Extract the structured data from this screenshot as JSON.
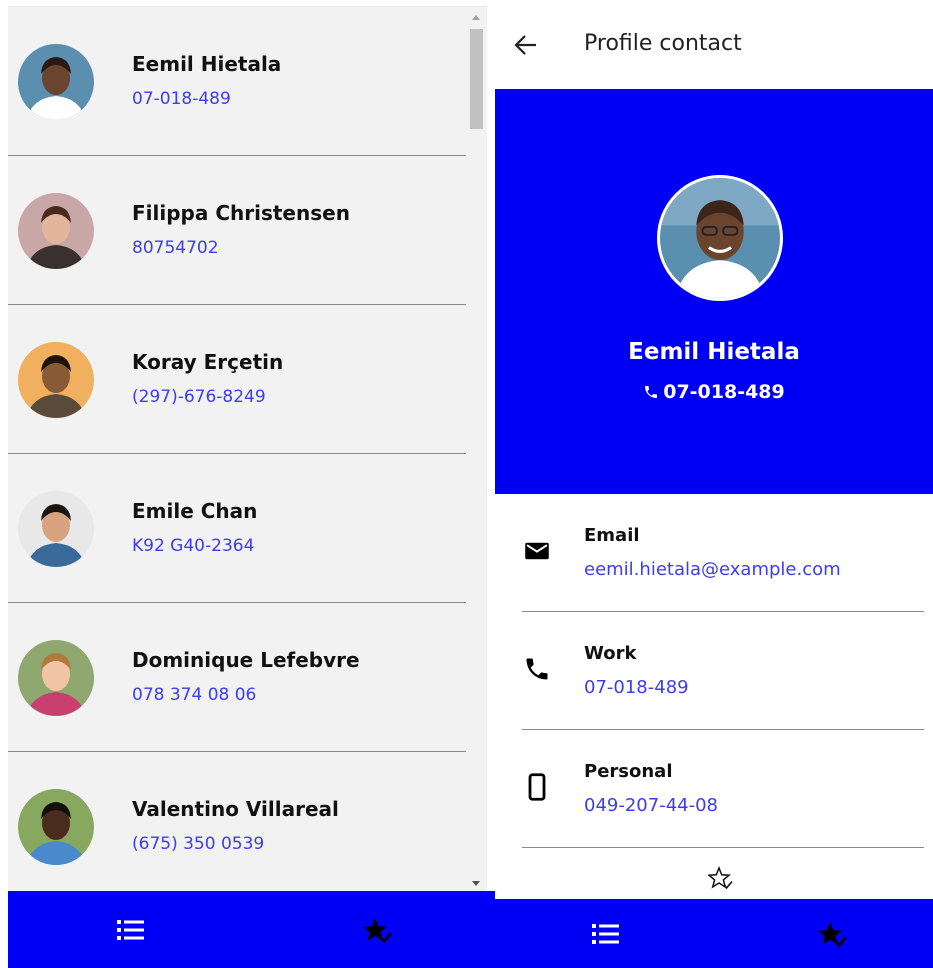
{
  "contacts": [
    {
      "name": "Eemil Hietala",
      "phone": "07-018-489",
      "skin": "#6b4430",
      "bg": "#5a8fb0",
      "hair": "#2a1a12",
      "shirt": "#ffffff"
    },
    {
      "name": "Filippa Christensen",
      "phone": "80754702",
      "skin": "#e2b69a",
      "bg": "#c9a7a6",
      "hair": "#4a2a1c",
      "shirt": "#3a3030"
    },
    {
      "name": "Koray Erçetin",
      "phone": "(297)-676-8249",
      "skin": "#8a5a36",
      "bg": "#f0b060",
      "hair": "#1e140e",
      "shirt": "#5a4a3a"
    },
    {
      "name": "Emile Chan",
      "phone": "K92 G40-2364",
      "skin": "#d9a27e",
      "bg": "#e8e8e8",
      "hair": "#1b1410",
      "shirt": "#3a6a9a"
    },
    {
      "name": "Dominique Lefebvre",
      "phone": "078 374 08 06",
      "skin": "#f0c4a4",
      "bg": "#8fa870",
      "hair": "#b07a3c",
      "shirt": "#c94070"
    },
    {
      "name": "Valentino Villareal",
      "phone": "(675) 350 0539",
      "skin": "#4a2c1c",
      "bg": "#88a860",
      "hair": "#141010",
      "shirt": "#4a8acc"
    }
  ],
  "profile": {
    "header_title": "Profile contact",
    "name": "Eemil Hietala",
    "phone": "07-018-489",
    "details": [
      {
        "label": "Email",
        "value": "eemil.hietala@example.com",
        "icon": "mail-icon"
      },
      {
        "label": "Work",
        "value": "07-018-489",
        "icon": "phone-icon"
      },
      {
        "label": "Personal",
        "value": "049-207-44-08",
        "icon": "smartphone-icon"
      }
    ]
  },
  "nav": {
    "items": [
      {
        "icon": "list-icon"
      },
      {
        "icon": "favorites-star-icon"
      }
    ]
  },
  "colors": {
    "accent": "#0000f5",
    "link": "#3d3df0",
    "list_bg": "#f2f2f2"
  }
}
